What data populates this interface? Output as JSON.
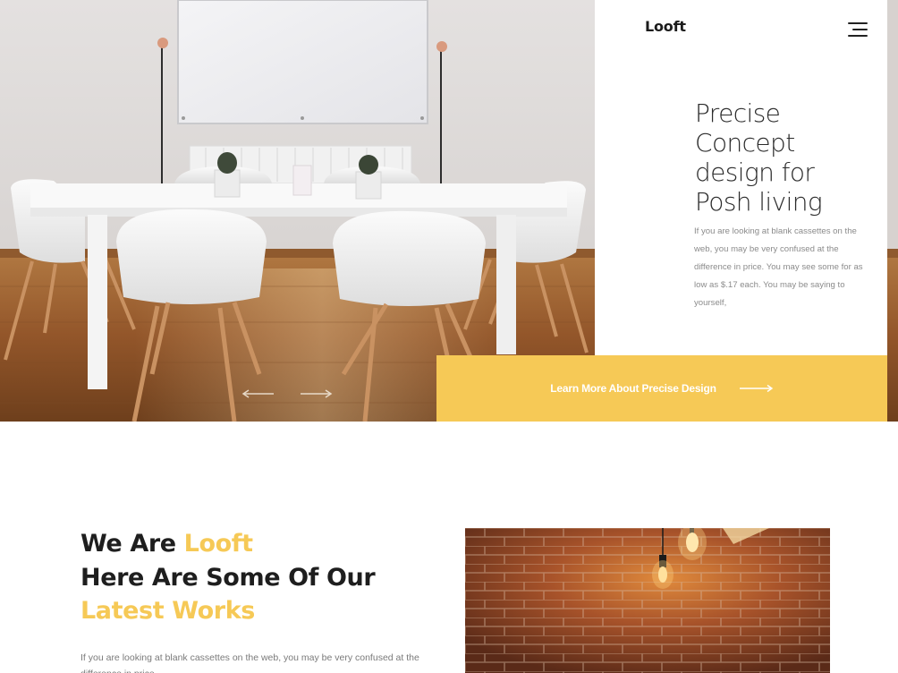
{
  "header": {
    "brand": "Looft",
    "menu_icon": "hamburger-menu-icon"
  },
  "hero": {
    "image_alt": "white meeting table with chairs",
    "title_lines": [
      "Precise",
      "Concept",
      "design for",
      "Posh living"
    ],
    "description": "If you are looking at blank cassettes on the web, you may be very confused at the difference in price. You may see some for as low as $.17 each. You may be saying to yourself,",
    "cta_label": "Learn More About Precise Design",
    "cta_icon": "arrow-right-icon"
  },
  "about": {
    "title_line1_prefix": "We Are ",
    "title_line1_accent": "Looft",
    "title_line2": "Here Are Some Of Our",
    "title_line3_accent": "Latest Works",
    "description": "If you are looking at blank cassettes on the web, you may be very confused at the difference in price."
  },
  "colors": {
    "accent": "#f6c956",
    "text_dark": "#1e1e1e",
    "text_muted": "#8b8b8b"
  }
}
